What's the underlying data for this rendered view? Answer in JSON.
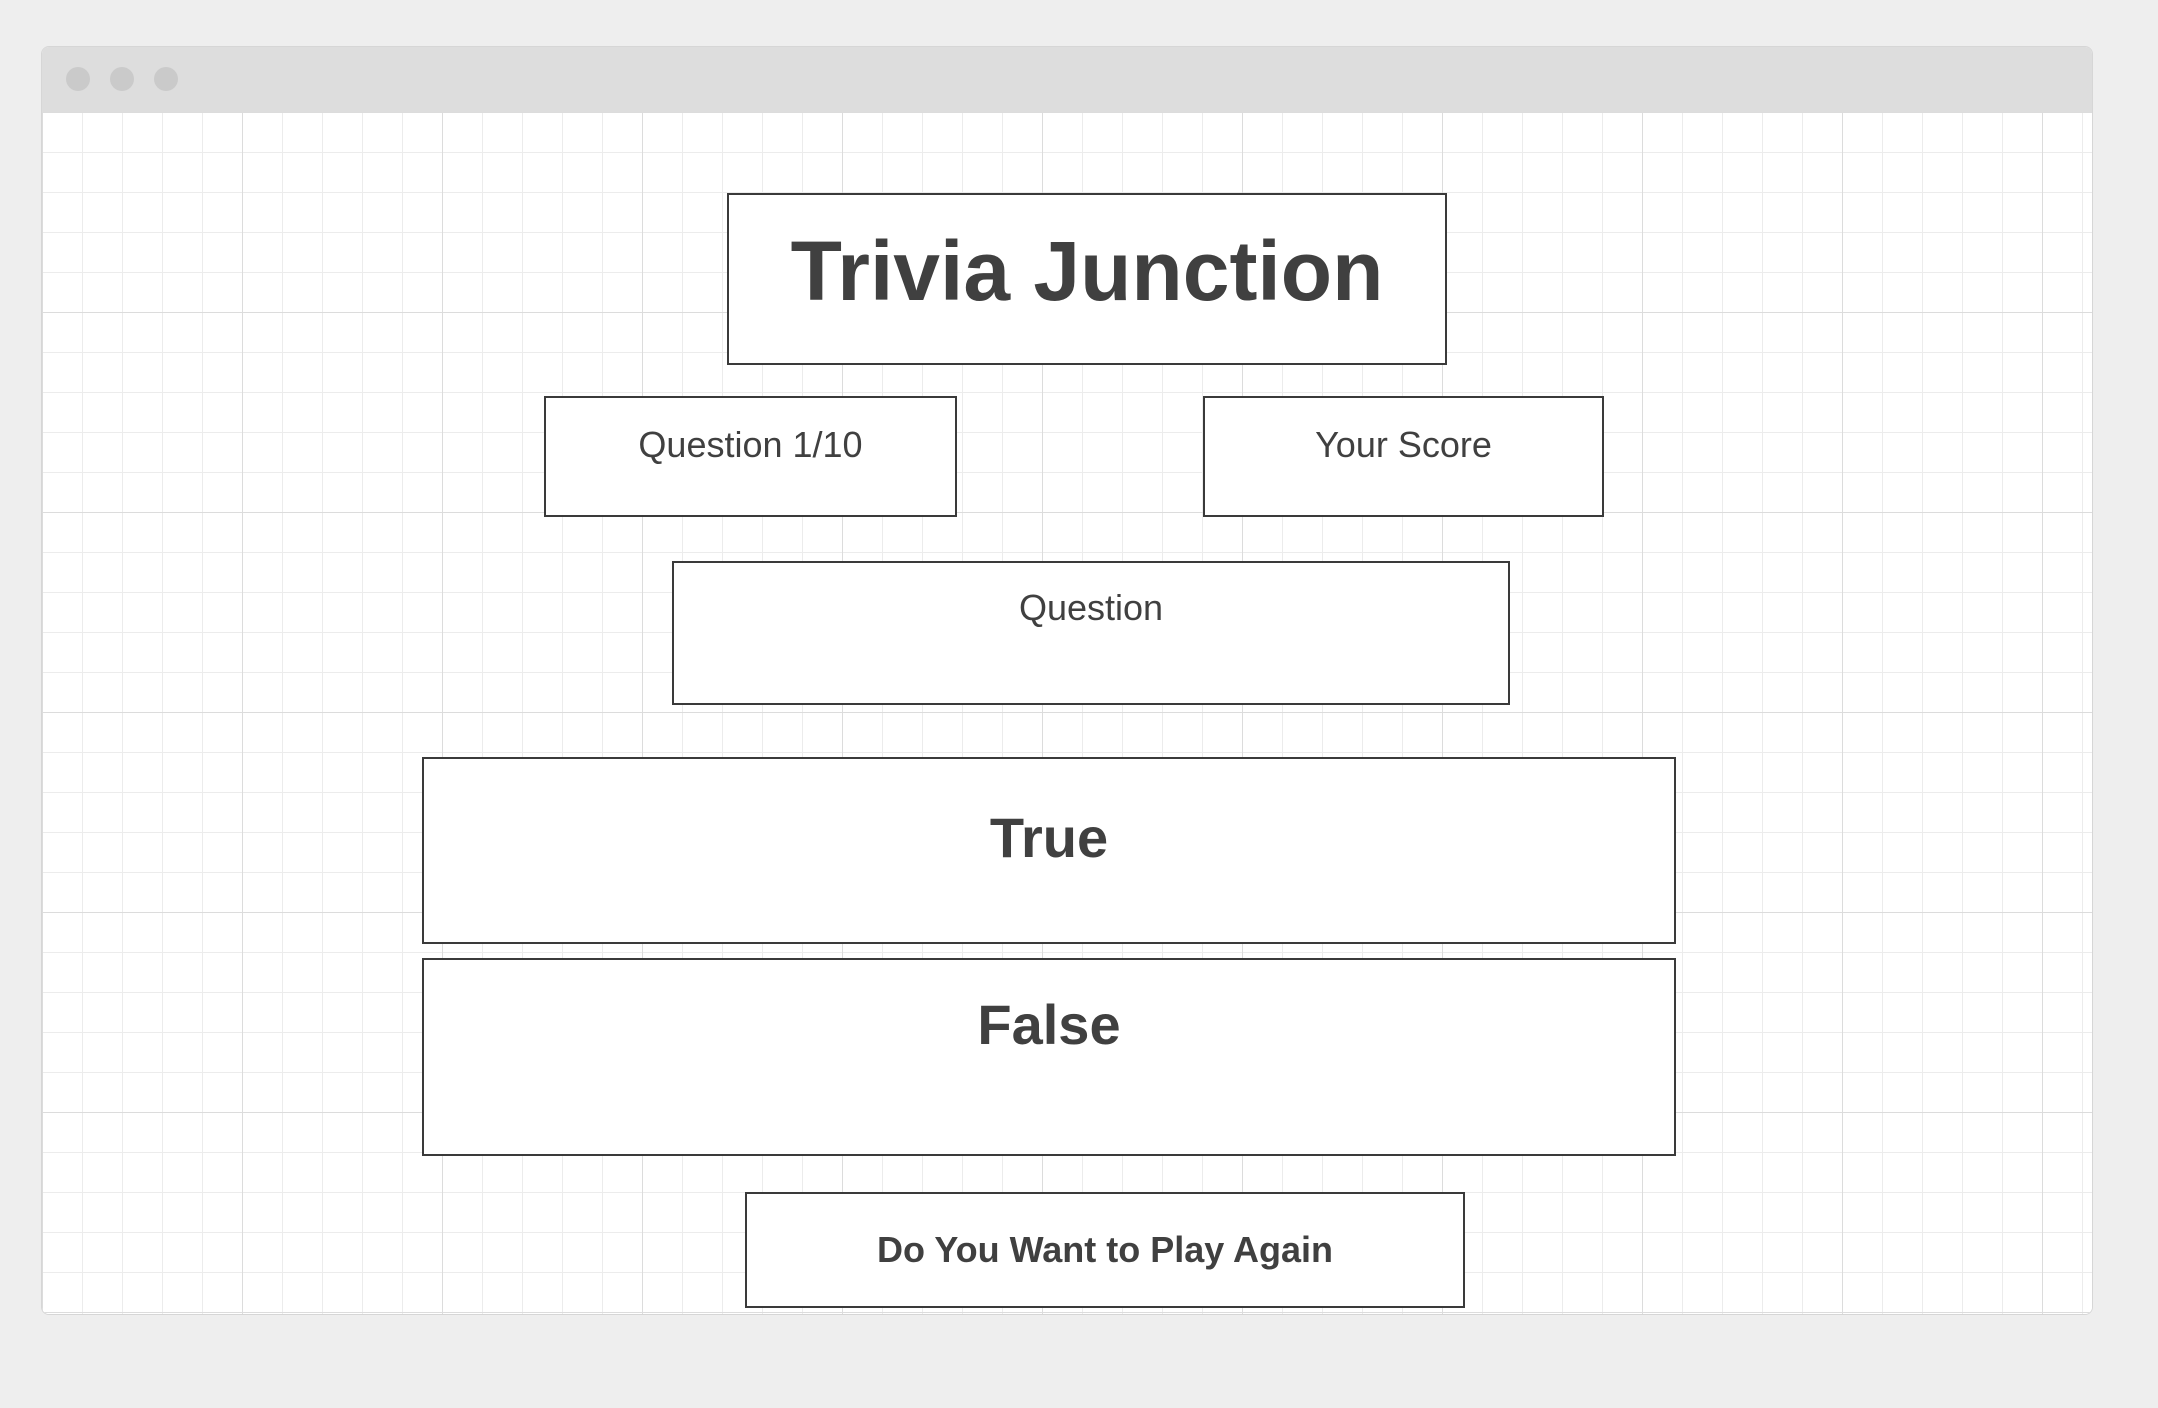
{
  "app": {
    "title": "Trivia Junction"
  },
  "status": {
    "question_counter": "Question 1/10",
    "score_label": "Your Score"
  },
  "question": {
    "text": "Question"
  },
  "answers": [
    {
      "label": "True"
    },
    {
      "label": "False"
    }
  ],
  "actions": {
    "play_again_label": "Do You Want to Play Again"
  },
  "colors": {
    "text": "#404040",
    "border": "#3a3a3a",
    "titlebar": "#dddddd",
    "background": "#eeeeee"
  }
}
